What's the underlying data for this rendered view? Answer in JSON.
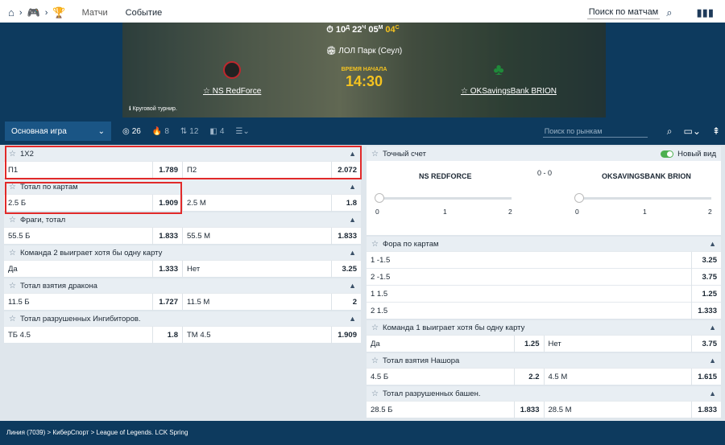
{
  "nav": {
    "tabs": [
      "Матчи",
      "Событие"
    ],
    "search": "Поиск по матчам"
  },
  "banner": {
    "timer": {
      "days": "10",
      "d_unit": "Д",
      "hours": "22",
      "h_unit": "Ч",
      "minutes": "05",
      "m_unit": "М",
      "seconds": "04",
      "s_unit": "С"
    },
    "venue": "ЛОЛ Парк (Сеул)",
    "team1": "NS RedForce",
    "team2": "OKSavingsBank BRION",
    "start_label": "ВРЕМЯ НАЧАЛА",
    "start_time": "14:30",
    "tournament": "Круговой турнир."
  },
  "marketbar": {
    "main_game": "Основная игра",
    "filters": [
      {
        "icon": "◎",
        "count": "26"
      },
      {
        "icon": "🔥",
        "count": "8"
      },
      {
        "icon": "⇅",
        "count": "12"
      },
      {
        "icon": "◧",
        "count": "4"
      }
    ],
    "search_placeholder": "Поиск по рынкам"
  },
  "left_markets": [
    {
      "title": "1X2",
      "rows": [
        [
          {
            "l": "П1",
            "o": "1.789"
          },
          {
            "l": "П2",
            "o": "2.072"
          }
        ]
      ]
    },
    {
      "title": "Тотал по картам",
      "rows": [
        [
          {
            "l": "2.5 Б",
            "o": "1.909"
          },
          {
            "l": "2.5 М",
            "o": "1.8"
          }
        ]
      ]
    },
    {
      "title": "Фраги, тотал",
      "rows": [
        [
          {
            "l": "55.5 Б",
            "o": "1.833"
          },
          {
            "l": "55.5 М",
            "o": "1.833"
          }
        ]
      ]
    },
    {
      "title": "Команда 2 выиграет хотя бы одну карту",
      "rows": [
        [
          {
            "l": "Да",
            "o": "1.333"
          },
          {
            "l": "Нет",
            "o": "3.25"
          }
        ]
      ]
    },
    {
      "title": "Тотал взятия дракона",
      "rows": [
        [
          {
            "l": "11.5 Б",
            "o": "1.727"
          },
          {
            "l": "11.5 М",
            "o": "2"
          }
        ]
      ]
    },
    {
      "title": "Тотал разрушенных Ингибиторов.",
      "rows": [
        [
          {
            "l": "ТБ 4.5",
            "o": "1.8"
          },
          {
            "l": "ТМ 4.5",
            "o": "1.909"
          }
        ]
      ]
    }
  ],
  "correct_score": {
    "title": "Точный счет",
    "new_view": "Новый вид",
    "team1": "NS REDFORCE",
    "score": "0 - 0",
    "team2": "OKSAVINGSBANK BRION",
    "ticks": [
      "0",
      "1",
      "2"
    ]
  },
  "right_markets": [
    {
      "title": "Фора по картам",
      "rows": [
        [
          {
            "l": "1 -1.5",
            "o": "3.25"
          }
        ],
        [
          {
            "l": "2 -1.5",
            "o": "3.75"
          }
        ],
        [
          {
            "l": "1 1.5",
            "o": "1.25"
          }
        ],
        [
          {
            "l": "2 1.5",
            "o": "1.333"
          }
        ]
      ]
    },
    {
      "title": "Команда 1 выиграет хотя бы одну карту",
      "rows": [
        [
          {
            "l": "Да",
            "o": "1.25"
          },
          {
            "l": "Нет",
            "o": "3.75"
          }
        ]
      ]
    },
    {
      "title": "Тотал взятия Нашора",
      "rows": [
        [
          {
            "l": "4.5 Б",
            "o": "2.2"
          },
          {
            "l": "4.5 М",
            "o": "1.615"
          }
        ]
      ]
    },
    {
      "title": "Тотал разрушенных башен.",
      "rows": [
        [
          {
            "l": "28.5 Б",
            "o": "1.833"
          },
          {
            "l": "28.5 М",
            "o": "1.833"
          }
        ]
      ]
    }
  ],
  "footer": "Линия (7039) > КиберСпорт > League of Legends. LCK Spring"
}
